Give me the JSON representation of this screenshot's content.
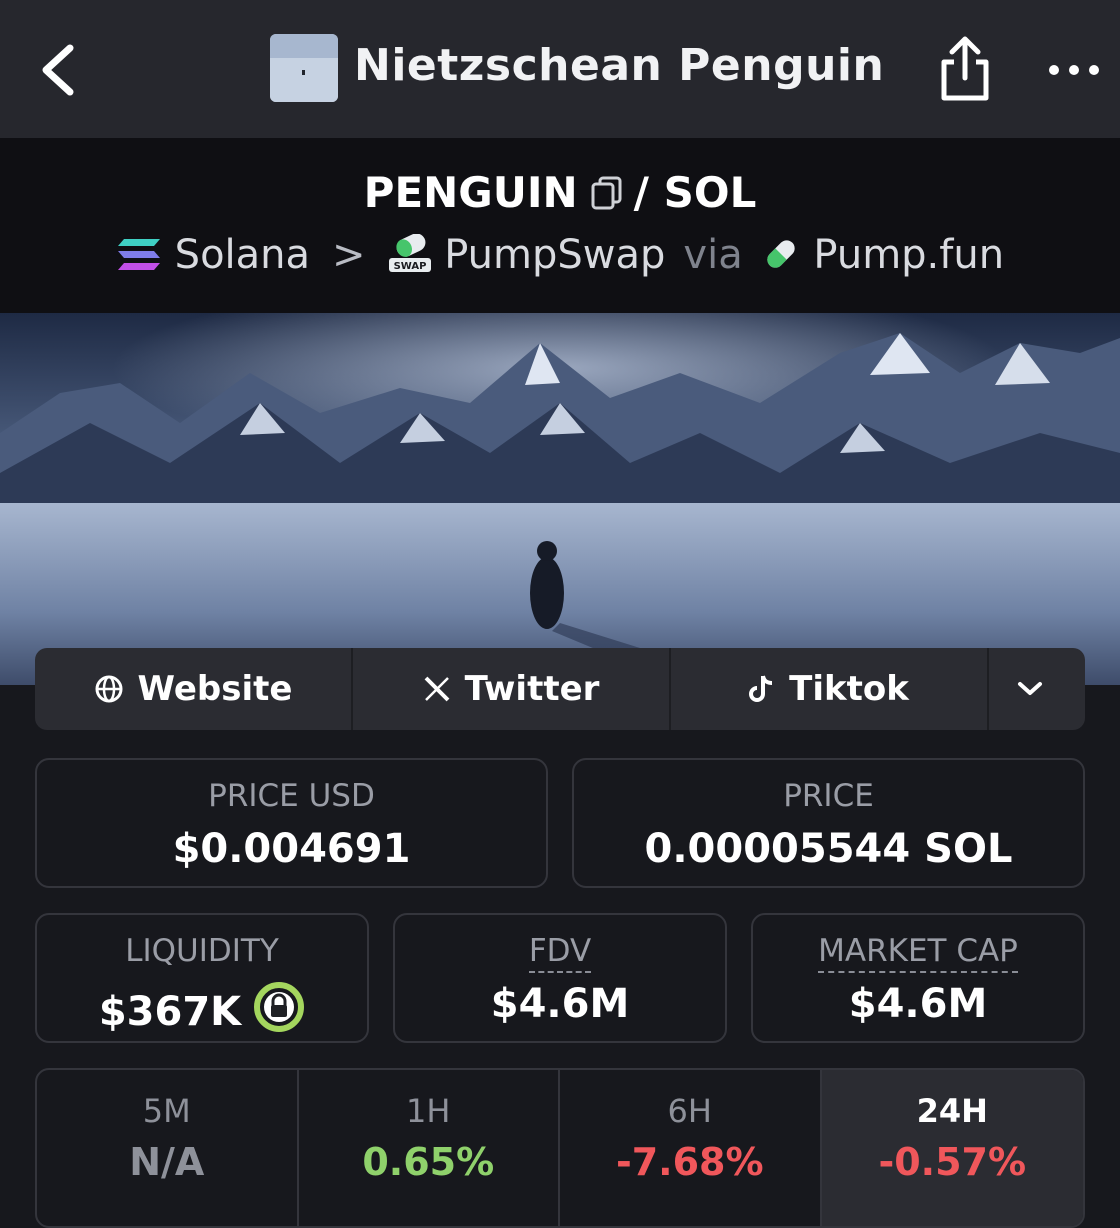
{
  "nav": {
    "title": "Nietzschean Penguin"
  },
  "pair": {
    "base": "PENGUIN",
    "quote": "SOL",
    "separator": "/"
  },
  "chain": {
    "network": "Solana",
    "dex": "PumpSwap",
    "via_label": "via",
    "launchpad": "Pump.fun",
    "swap_badge": "SWAP"
  },
  "links": {
    "website": "Website",
    "twitter": "Twitter",
    "tiktok": "Tiktok"
  },
  "stats": {
    "price_usd_label": "PRICE USD",
    "price_usd": "$0.004691",
    "price_label": "PRICE",
    "price": "0.00005544 SOL",
    "liquidity_label": "LIQUIDITY",
    "liquidity": "$367K",
    "fdv_label": "FDV",
    "fdv": "$4.6M",
    "mcap_label": "MARKET CAP",
    "mcap": "$4.6M"
  },
  "timeframes": [
    {
      "label": "5M",
      "value": "N/A",
      "color": "#8e919a"
    },
    {
      "label": "1H",
      "value": "0.65%",
      "color": "#8fd16b"
    },
    {
      "label": "6H",
      "value": "-7.68%",
      "color": "#f0575b"
    },
    {
      "label": "24H",
      "value": "-0.57%",
      "color": "#f0575b",
      "selected": true
    }
  ],
  "colors": {
    "accent_green": "#8fd16b",
    "negative_red": "#f0575b",
    "lock_green": "#a4d65e"
  }
}
